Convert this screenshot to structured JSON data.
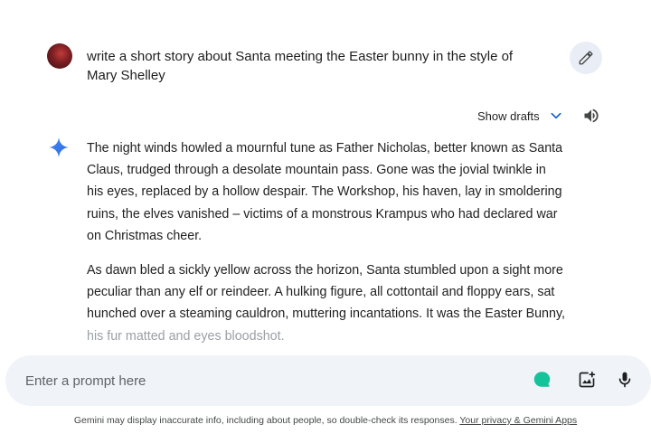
{
  "user_prompt": {
    "avatar_icon": "user-avatar",
    "text": "write a short story about Santa meeting the Easter bunny in the style of Mary Shelley",
    "edit_icon": "pencil-icon"
  },
  "response_toolbar": {
    "show_drafts_label": "Show drafts",
    "chevron_icon": "chevron-down-icon",
    "speaker_icon": "speaker-icon",
    "accent_color": "#0b57d0"
  },
  "response": {
    "icon": "gemini-sparkle-icon",
    "paragraphs": [
      "The night winds howled a mournful tune as Father Nicholas, better known as Santa Claus, trudged through a desolate mountain pass. Gone was the jovial twinkle in his eyes, replaced by a hollow despair. The Workshop, his haven, lay in smoldering ruins, the elves vanished – victims of a monstrous Krampus who had declared war on Christmas cheer.",
      "As dawn bled a sickly yellow across the horizon, Santa stumbled upon a sight more peculiar than any elf or reindeer. A hulking figure, all cottontail and floppy ears, sat hunched over a steaming cauldron, muttering incantations. It was the Easter Bunny,"
    ],
    "faded_line": "his fur matted and eyes bloodshot."
  },
  "prompt_bar": {
    "placeholder": "Enter a prompt here",
    "value": "",
    "grammar_icon": "grammarly-icon",
    "grammar_color": "#15c39a",
    "image_icon": "add-image-icon",
    "mic_icon": "microphone-icon",
    "background_color": "#f0f4f9"
  },
  "footer": {
    "disclaimer": "Gemini may display inaccurate info, including about people, so double-check its responses.",
    "privacy_link": "Your privacy & Gemini Apps"
  }
}
